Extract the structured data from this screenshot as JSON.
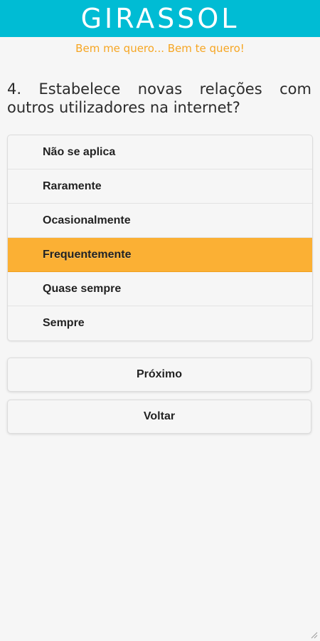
{
  "header": {
    "logo_text": "GIRASSOL",
    "tagline": "Bem me quero... Bem te quero!"
  },
  "question": {
    "text": "4. Estabelece novas relações com outros utilizadores na internet?"
  },
  "options": [
    {
      "label": "Não se aplica",
      "selected": false
    },
    {
      "label": "Raramente",
      "selected": false
    },
    {
      "label": "Ocasionalmente",
      "selected": false
    },
    {
      "label": "Frequentemente",
      "selected": true
    },
    {
      "label": "Quase sempre",
      "selected": false
    },
    {
      "label": "Sempre",
      "selected": false
    }
  ],
  "buttons": {
    "next_label": "Próximo",
    "back_label": "Voltar"
  },
  "colors": {
    "header_bg": "#00bcd4",
    "tagline": "#f6a623",
    "selected_bg": "#fbb034"
  },
  "icons": {
    "resize_grip": "resize-grip-icon"
  }
}
